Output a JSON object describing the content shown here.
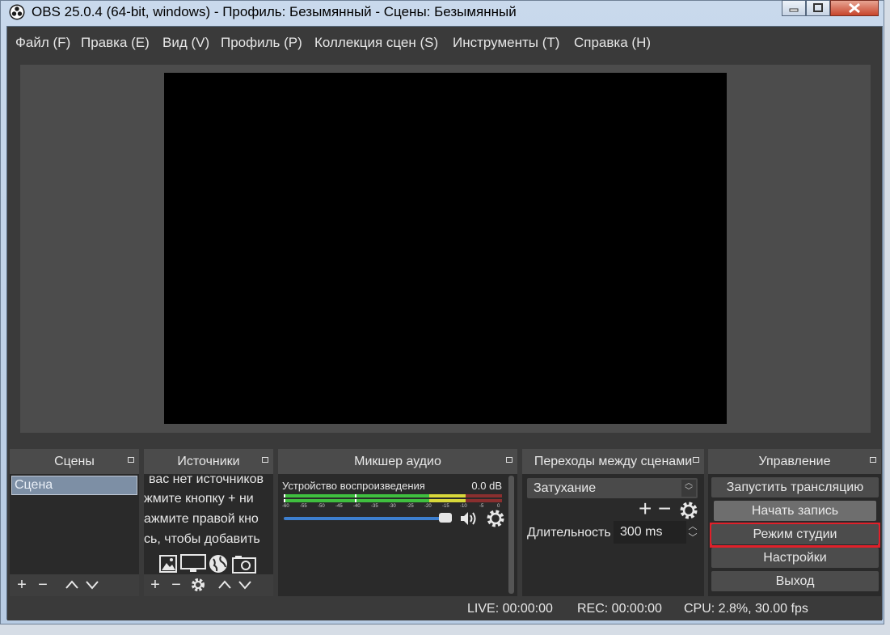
{
  "window": {
    "title": "OBS 25.0.4 (64-bit, windows) - Профиль: Безымянный - Сцены: Безымянный"
  },
  "menu": [
    "Файл (F)",
    "Правка (E)",
    "Вид (V)",
    "Профиль (P)",
    "Коллекция сцен (S)",
    "Инструменты (T)",
    "Справка (H)"
  ],
  "scenes": {
    "title": "Сцены",
    "items": [
      "Сцена"
    ]
  },
  "sources": {
    "title": "Источники",
    "hint_lines": [
      "вас нет источников",
      "жмите кнопку + ни",
      "ажмите правой кно",
      "сь, чтобы добавить"
    ],
    "icons": [
      "image-icon",
      "display-icon",
      "globe-icon",
      "camera-icon"
    ]
  },
  "mixer": {
    "title": "Микшер аудио",
    "device_name": "Устройство воспроизведения",
    "level": "0.0 dB",
    "ticks": [
      "-60",
      "-55",
      "-50",
      "-45",
      "-40",
      "-35",
      "-30",
      "-25",
      "-20",
      "-15",
      "-10",
      "-5",
      "0"
    ]
  },
  "transitions": {
    "title": "Переходы между сценами",
    "selected": "Затухание",
    "duration_label": "Длительность",
    "duration_value": "300 ms"
  },
  "controls": {
    "title": "Управление",
    "start_stream": "Запустить трансляцию",
    "start_record": "Начать запись",
    "studio_mode": "Режим студии",
    "settings": "Настройки",
    "exit": "Выход"
  },
  "status": {
    "live": "LIVE: 00:00:00",
    "rec": "REC: 00:00:00",
    "cpu": "CPU: 2.8%, 30.00 fps"
  },
  "colors": {
    "highlight": "#e0202a",
    "meter_green": "#3fbf3f",
    "meter_yellow": "#d8d83a",
    "meter_red": "#c83a3a",
    "volume": "#3d7fcf"
  }
}
